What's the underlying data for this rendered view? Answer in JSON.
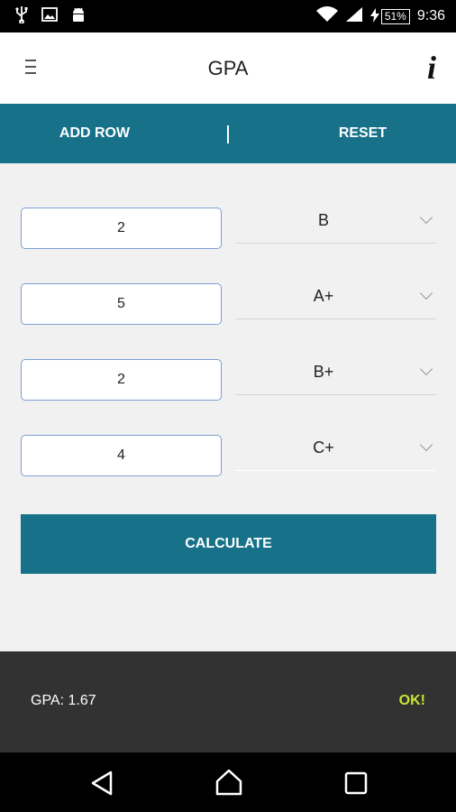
{
  "status_bar": {
    "time": "9:36",
    "battery": "51%",
    "icons": [
      "usb-icon",
      "image-icon",
      "android-icon",
      "wifi-icon",
      "signal-icon",
      "battery-icon"
    ]
  },
  "app_bar": {
    "title": "GPA",
    "info_glyph": "i"
  },
  "toolbar": {
    "add_row_label": "ADD ROW",
    "reset_label": "RESET"
  },
  "courses": [
    {
      "credits": "2",
      "grade": "B"
    },
    {
      "credits": "5",
      "grade": "A+"
    },
    {
      "credits": "2",
      "grade": "B+"
    },
    {
      "credits": "4",
      "grade": "C+"
    }
  ],
  "calculate_label": "CALCULATE",
  "snackbar": {
    "message": "GPA: 1.67",
    "action": "OK!"
  },
  "colors": {
    "accent": "#167189",
    "snackbar_action": "#c6e633"
  }
}
